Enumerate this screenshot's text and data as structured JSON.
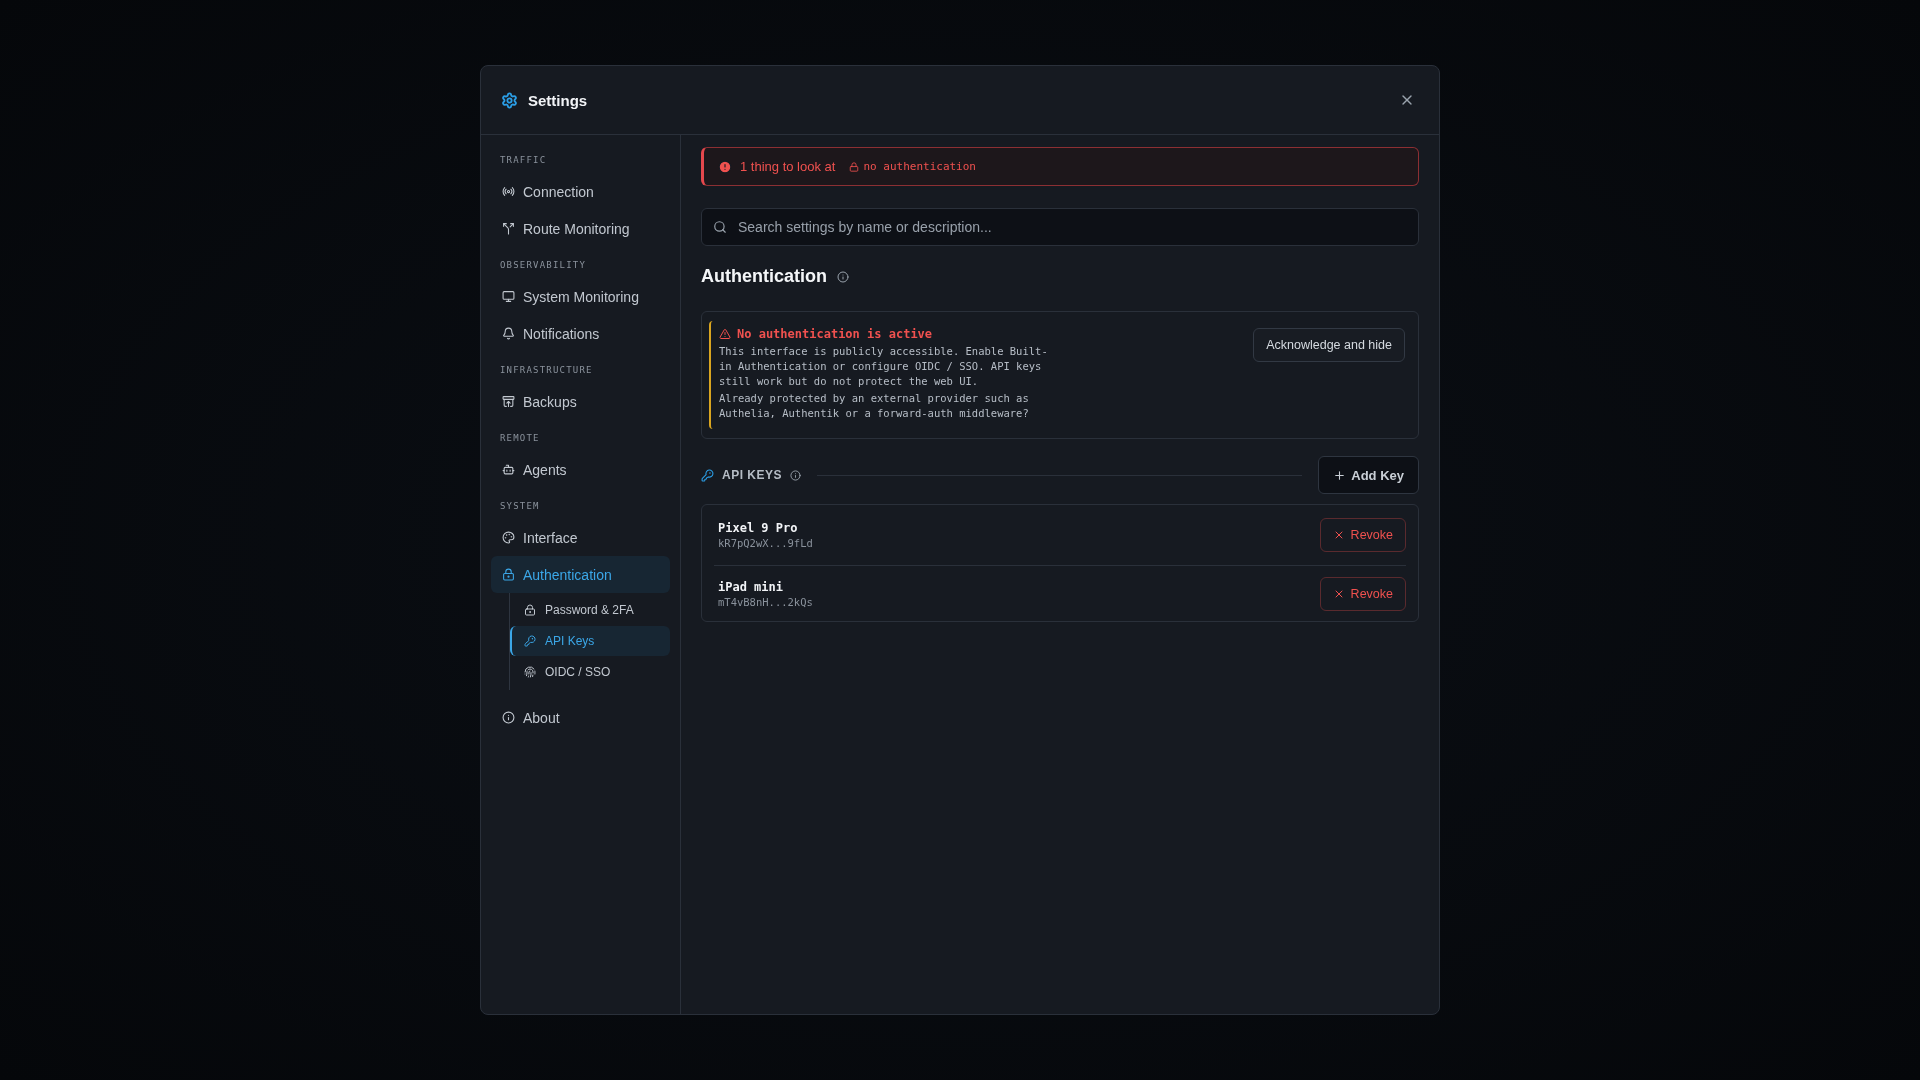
{
  "window": {
    "title": "Settings"
  },
  "sidebar": {
    "sections": [
      {
        "heading": "TRAFFIC",
        "items": [
          {
            "label": "Connection",
            "selected": false
          },
          {
            "label": "Route Monitoring",
            "selected": false
          }
        ]
      },
      {
        "heading": "OBSERVABILITY",
        "items": [
          {
            "label": "System Monitoring",
            "selected": false
          },
          {
            "label": "Notifications",
            "selected": false
          }
        ]
      },
      {
        "heading": "INFRASTRUCTURE",
        "items": [
          {
            "label": "Backups",
            "selected": false
          }
        ]
      },
      {
        "heading": "REMOTE",
        "items": [
          {
            "label": "Agents",
            "selected": false
          }
        ]
      },
      {
        "heading": "SYSTEM",
        "items": [
          {
            "label": "Interface",
            "selected": false
          },
          {
            "label": "Authentication",
            "selected": true,
            "children": [
              {
                "label": "Password & 2FA",
                "selected": false
              },
              {
                "label": "API Keys",
                "selected": true
              },
              {
                "label": "OIDC / SSO",
                "selected": false
              }
            ]
          }
        ]
      },
      {
        "items": [
          {
            "label": "About",
            "selected": false
          }
        ]
      }
    ]
  },
  "issues_banner": {
    "text": "1 thing to look at",
    "tag": "no authentication"
  },
  "search": {
    "placeholder": "Search settings by name or description..."
  },
  "section_title": "Authentication",
  "warning": {
    "title": "No authentication is active",
    "paragraphs": [
      "This interface is publicly accessible. Enable Built-in Authentication or configure OIDC / SSO. API keys still work but do not protect the web UI.",
      "Already protected by an external provider such as Authelia, Authentik or a forward-auth middleware?"
    ],
    "button": "Acknowledge and hide"
  },
  "api_keys": {
    "heading": "API KEYS",
    "add_button": "Add Key",
    "keys": [
      {
        "name": "Pixel 9 Pro",
        "key": "kR7pQ2wX...9fLd",
        "action": "Revoke"
      },
      {
        "name": "iPad mini",
        "key": "mT4vB8nH...2kQs",
        "action": "Revoke"
      }
    ]
  }
}
